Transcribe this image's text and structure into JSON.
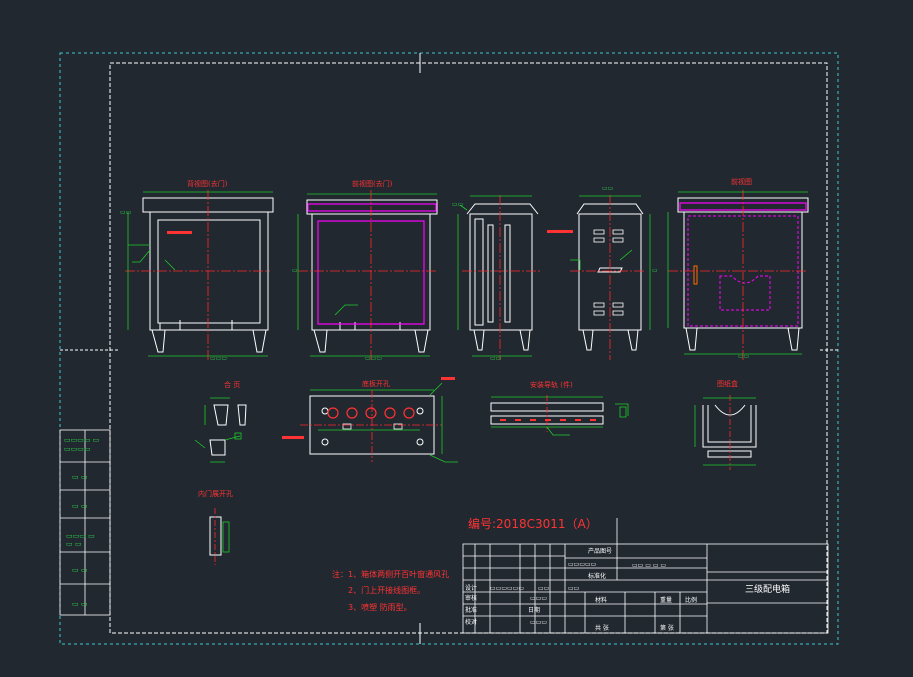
{
  "drawing": {
    "number_label": "编号:2018C3011（A）",
    "title_block_name": "三级配电箱",
    "notes": [
      "注：1、箱体两侧开百叶窗通风孔",
      "2、门上开接线图框。",
      "3、喷塑   防雨型。"
    ],
    "view_titles": {
      "front_open": "背视图(去门)",
      "front_closed": "前视图(去门)",
      "side": "",
      "left": "",
      "back": "前视图",
      "hinge": "合 页",
      "bottom_plate": "底板开孔",
      "mount_rail": "安装导轨  (件)",
      "drawing_box": "图纸盒",
      "inner_door": "内门展开孔"
    },
    "title_block_texts": [
      "产品图号",
      "审核",
      "批准",
      "日期",
      "标准化",
      "比例",
      "设计",
      "校对",
      "材料",
      "共  张",
      "第  张",
      "重量"
    ],
    "colors": {
      "background": "#212830",
      "frame": "#3ec9d0",
      "border": "#ffffff",
      "outline": "#ffffff",
      "dimension": "#1ecb2a",
      "centerline": "#ff2a2a",
      "highlight": "#ff00ff",
      "annotation": "#ff3333",
      "label_green": "#2ed34a"
    }
  }
}
